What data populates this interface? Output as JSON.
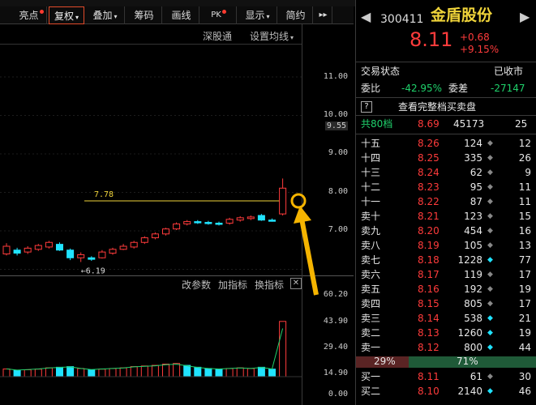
{
  "toolbar": {
    "items": [
      {
        "label": "亮点",
        "dot": true,
        "caret": false
      },
      {
        "label": "复权",
        "dot": false,
        "caret": true
      },
      {
        "label": "叠加",
        "dot": false,
        "caret": true
      },
      {
        "label": "筹码",
        "dot": false,
        "caret": false
      },
      {
        "label": "画线",
        "dot": false,
        "caret": false
      },
      {
        "label": "PK",
        "dot": true,
        "caret": false
      },
      {
        "label": "显示",
        "dot": false,
        "caret": true
      },
      {
        "label": "简约",
        "dot": false,
        "caret": false
      },
      {
        "label": "▸▸",
        "dot": false,
        "caret": false
      }
    ]
  },
  "chart_links": {
    "shenGuTong": "深股通",
    "setMA": "设置均线"
  },
  "indicator_links": {
    "changeParam": "改参数",
    "addIndicator": "加指标",
    "switchIndicator": "换指标",
    "close": "✕"
  },
  "price_axis": {
    "ticks": [
      "11.00",
      "10.00",
      "9.55",
      "9.00",
      "8.00",
      "7.00"
    ]
  },
  "volume_axis": {
    "ticks": [
      "60.20",
      "43.90",
      "29.40",
      "14.90",
      "0.00"
    ]
  },
  "annotations": {
    "high_line": "7.78",
    "low_label": "←6.19"
  },
  "candles": [
    {
      "o": 6.4,
      "c": 6.6,
      "h": 6.68,
      "l": 6.36
    },
    {
      "o": 6.5,
      "c": 6.42,
      "h": 6.56,
      "l": 6.36
    },
    {
      "o": 6.45,
      "c": 6.55,
      "h": 6.6,
      "l": 6.4
    },
    {
      "o": 6.52,
      "c": 6.62,
      "h": 6.66,
      "l": 6.48
    },
    {
      "o": 6.58,
      "c": 6.7,
      "h": 6.74,
      "l": 6.54
    },
    {
      "o": 6.65,
      "c": 6.5,
      "h": 6.7,
      "l": 6.48
    },
    {
      "o": 6.5,
      "c": 6.3,
      "h": 6.54,
      "l": 6.24
    },
    {
      "o": 6.3,
      "c": 6.38,
      "h": 6.44,
      "l": 6.19
    },
    {
      "o": 6.3,
      "c": 6.26,
      "h": 6.34,
      "l": 6.22
    },
    {
      "o": 6.3,
      "c": 6.45,
      "h": 6.5,
      "l": 6.28
    },
    {
      "o": 6.42,
      "c": 6.52,
      "h": 6.56,
      "l": 6.38
    },
    {
      "o": 6.52,
      "c": 6.6,
      "h": 6.66,
      "l": 6.5
    },
    {
      "o": 6.58,
      "c": 6.7,
      "h": 6.74,
      "l": 6.54
    },
    {
      "o": 6.7,
      "c": 6.82,
      "h": 6.86,
      "l": 6.66
    },
    {
      "o": 6.82,
      "c": 6.92,
      "h": 6.96,
      "l": 6.78
    },
    {
      "o": 6.92,
      "c": 7.05,
      "h": 7.08,
      "l": 6.88
    },
    {
      "o": 7.05,
      "c": 7.18,
      "h": 7.22,
      "l": 7.02
    },
    {
      "o": 7.18,
      "c": 7.24,
      "h": 7.28,
      "l": 7.14
    },
    {
      "o": 7.24,
      "c": 7.22,
      "h": 7.28,
      "l": 7.18
    },
    {
      "o": 7.22,
      "c": 7.2,
      "h": 7.26,
      "l": 7.16
    },
    {
      "o": 7.2,
      "c": 7.18,
      "h": 7.24,
      "l": 7.14
    },
    {
      "o": 7.2,
      "c": 7.3,
      "h": 7.34,
      "l": 7.16
    },
    {
      "o": 7.28,
      "c": 7.34,
      "h": 7.38,
      "l": 7.24
    },
    {
      "o": 7.32,
      "c": 7.36,
      "h": 7.4,
      "l": 7.28
    },
    {
      "o": 7.4,
      "c": 7.28,
      "h": 7.44,
      "l": 7.26
    },
    {
      "o": 7.28,
      "c": 7.26,
      "h": 7.32,
      "l": 7.24
    },
    {
      "o": 7.44,
      "c": 8.11,
      "h": 8.36,
      "l": 7.4
    }
  ],
  "volumes": [
    {
      "v": 6.1,
      "up": true
    },
    {
      "v": 5.0,
      "up": false
    },
    {
      "v": 5.5,
      "up": true
    },
    {
      "v": 6.0,
      "up": true
    },
    {
      "v": 7.0,
      "up": true
    },
    {
      "v": 7.5,
      "up": false
    },
    {
      "v": 8.0,
      "up": false
    },
    {
      "v": 6.5,
      "up": true
    },
    {
      "v": 5.5,
      "up": false
    },
    {
      "v": 6.0,
      "up": true
    },
    {
      "v": 6.5,
      "up": true
    },
    {
      "v": 7.0,
      "up": true
    },
    {
      "v": 8.0,
      "up": true
    },
    {
      "v": 8.5,
      "up": true
    },
    {
      "v": 9.0,
      "up": true
    },
    {
      "v": 10.0,
      "up": true
    },
    {
      "v": 10.5,
      "up": true
    },
    {
      "v": 9.0,
      "up": false
    },
    {
      "v": 7.5,
      "up": false
    },
    {
      "v": 6.5,
      "up": false
    },
    {
      "v": 6.0,
      "up": false
    },
    {
      "v": 6.5,
      "up": true
    },
    {
      "v": 7.0,
      "up": true
    },
    {
      "v": 6.5,
      "up": true
    },
    {
      "v": 7.5,
      "up": false
    },
    {
      "v": 6.0,
      "up": false
    },
    {
      "v": 44.0,
      "up": true
    }
  ],
  "stock": {
    "code": "300411",
    "name": "金盾股份",
    "price": "8.11",
    "change": "+0.68",
    "pct": "+9.15%"
  },
  "status": {
    "label": "交易状态",
    "value": "已收市"
  },
  "ratio": {
    "wb_label": "委比",
    "wb_value": "-42.95%",
    "wc_label": "委差",
    "wc_value": "-27147"
  },
  "full_book": {
    "help": "?",
    "label": "查看完整档买卖盘"
  },
  "total_row": {
    "label": "共80档",
    "price": "8.69",
    "vol": "45173",
    "count": "25"
  },
  "asks": [
    {
      "label": "十五",
      "price": "8.26",
      "vol": "124",
      "mark": "◆",
      "mark_color": "gray",
      "cnt": "12"
    },
    {
      "label": "十四",
      "price": "8.25",
      "vol": "335",
      "mark": "◆",
      "mark_color": "gray",
      "cnt": "26"
    },
    {
      "label": "十三",
      "price": "8.24",
      "vol": "62",
      "mark": "◆",
      "mark_color": "gray",
      "cnt": "9"
    },
    {
      "label": "十二",
      "price": "8.23",
      "vol": "95",
      "mark": "◆",
      "mark_color": "gray",
      "cnt": "11"
    },
    {
      "label": "十一",
      "price": "8.22",
      "vol": "87",
      "mark": "◆",
      "mark_color": "gray",
      "cnt": "11"
    },
    {
      "label": "卖十",
      "price": "8.21",
      "vol": "123",
      "mark": "◆",
      "mark_color": "gray",
      "cnt": "15"
    },
    {
      "label": "卖九",
      "price": "8.20",
      "vol": "454",
      "mark": "◆",
      "mark_color": "gray",
      "cnt": "16"
    },
    {
      "label": "卖八",
      "price": "8.19",
      "vol": "105",
      "mark": "◆",
      "mark_color": "gray",
      "cnt": "13"
    },
    {
      "label": "卖七",
      "price": "8.18",
      "vol": "1228",
      "mark": "◆",
      "mark_color": "cyan",
      "cnt": "77"
    },
    {
      "label": "卖六",
      "price": "8.17",
      "vol": "119",
      "mark": "◆",
      "mark_color": "gray",
      "cnt": "17"
    },
    {
      "label": "卖五",
      "price": "8.16",
      "vol": "192",
      "mark": "◆",
      "mark_color": "gray",
      "cnt": "19"
    },
    {
      "label": "卖四",
      "price": "8.15",
      "vol": "805",
      "mark": "◆",
      "mark_color": "gray",
      "cnt": "17"
    },
    {
      "label": "卖三",
      "price": "8.14",
      "vol": "538",
      "mark": "◆",
      "mark_color": "cyan",
      "cnt": "21"
    },
    {
      "label": "卖二",
      "price": "8.13",
      "vol": "1260",
      "mark": "◆",
      "mark_color": "cyan",
      "cnt": "19"
    },
    {
      "label": "卖一",
      "price": "8.12",
      "vol": "800",
      "mark": "◆",
      "mark_color": "cyan",
      "cnt": "44"
    }
  ],
  "split": {
    "left": "29%",
    "right": "71%",
    "left_fraction": 0.29
  },
  "bids": [
    {
      "label": "买一",
      "price": "8.11",
      "vol": "61",
      "mark": "◆",
      "mark_color": "gray",
      "cnt": "30"
    },
    {
      "label": "买二",
      "price": "8.10",
      "vol": "2140",
      "mark": "◆",
      "mark_color": "cyan",
      "cnt": "46"
    }
  ],
  "colors": {
    "up": "#ff3b3b",
    "down": "#20e3ff",
    "ma": "#f0d43a",
    "accent": "#e24b2a"
  }
}
